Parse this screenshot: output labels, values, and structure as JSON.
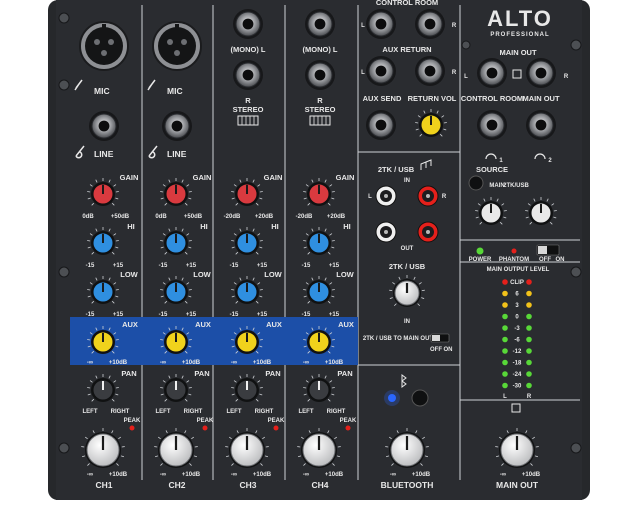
{
  "brand": {
    "name": "ALTO",
    "tagline": "PROFESSIONAL"
  },
  "colors": {
    "panel": "#26282b",
    "aux_strip": "#1c4fa8",
    "knob_gain": "#d93a3f",
    "knob_eq": "#2f8fe0",
    "knob_aux": "#f0d21c",
    "knob_gray": "#3a3c40",
    "knob_white": "#e9e9e9",
    "led_green": "#58d838",
    "led_yellow": "#f2c21a",
    "led_red": "#e5201b",
    "bt_blue": "#2a66ff"
  },
  "channels": [
    {
      "name": "CH1",
      "input_top": "MIC",
      "input_bottom": "LINE",
      "type": "mono"
    },
    {
      "name": "CH2",
      "input_top": "MIC",
      "input_bottom": "LINE",
      "type": "mono"
    },
    {
      "name": "CH3",
      "input_top": "(MONO) L",
      "input_bottom": "R",
      "bottom_label": "STEREO",
      "type": "stereo"
    },
    {
      "name": "CH4",
      "input_top": "(MONO) L",
      "input_bottom": "R",
      "bottom_label": "STEREO",
      "type": "stereo"
    }
  ],
  "strip_labels": {
    "gain": "GAIN",
    "hi": "HI",
    "low": "LOW",
    "aux": "AUX",
    "pan": "PAN",
    "peak": "PEAK",
    "left": "LEFT",
    "right": "RIGHT"
  },
  "scales": {
    "mono_gain": [
      "0dB",
      "+50dB"
    ],
    "stereo_gain": [
      "-20dB",
      "+20dB"
    ],
    "eq": [
      "-15",
      "+15"
    ],
    "aux": [
      "-∞",
      "+10dB"
    ],
    "level": [
      "-∞",
      "+10dB"
    ]
  },
  "center": {
    "control_room": "CONTROL ROOM",
    "aux_return": "AUX RETURN",
    "aux_send": "AUX SEND",
    "return_vol": "RETURN VOL",
    "two_tk_usb": "2TK / USB",
    "in": "IN",
    "out": "OUT",
    "two_tk_in": "IN",
    "two_tk_to_main": "2TK / USB TO MAIN OUT",
    "off": "OFF",
    "on": "ON",
    "bluetooth": "BLUETOOTH",
    "l": "L",
    "r": "R"
  },
  "right": {
    "main_out_top": "MAIN OUT",
    "control_room": "CONTROL ROOM",
    "main_out_jack": "MAIN OUT",
    "source": "SOURCE",
    "source_main": "MAIN",
    "source_2tk": "2TK/USB",
    "power": "POWER",
    "phantom": "PHANTOM",
    "phantom_off": "OFF",
    "phantom_on": "ON",
    "main_output_level": "MAIN OUTPUT LEVEL",
    "meter_labels": [
      "CLIP",
      "6",
      "3",
      "0",
      "-3",
      "-6",
      "-12",
      "-18",
      "-24",
      "-30"
    ],
    "main_out_knob": "MAIN OUT",
    "l": "L",
    "r": "R",
    "phones_1": "1",
    "phones_2": "2"
  }
}
